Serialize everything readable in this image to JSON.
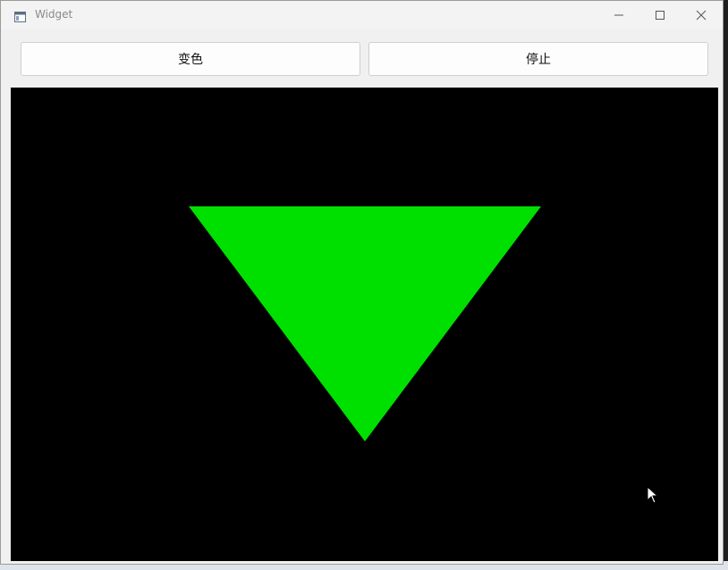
{
  "window": {
    "title": "Widget",
    "icon": "app-window-icon",
    "controls": [
      "minimize-icon",
      "maximize-icon",
      "close-icon"
    ]
  },
  "toolbar": {
    "color_label": "变色",
    "stop_label": "停止"
  },
  "canvas": {
    "background": "#000000",
    "shape": "triangle",
    "shape_color": "#00e000"
  }
}
